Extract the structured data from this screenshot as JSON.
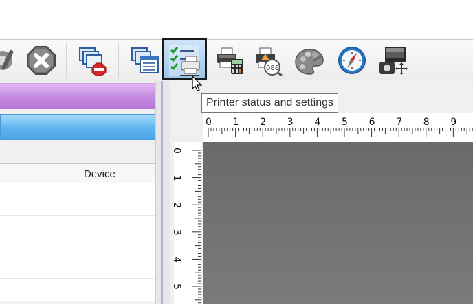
{
  "toolbar": {
    "buttons": [
      {
        "id": "tools",
        "icon": "tools-icon"
      },
      {
        "id": "cancel",
        "icon": "cancel-x-icon"
      },
      {
        "id": "stop-jobs",
        "icon": "stop-jobs-icon"
      },
      {
        "id": "job-list",
        "icon": "job-list-icon"
      },
      {
        "id": "printer-status",
        "icon": "printer-status-icon",
        "active": true
      },
      {
        "id": "printer-calculator",
        "icon": "printer-calculator-icon"
      },
      {
        "id": "printer-counter",
        "icon": "printer-counter-icon"
      },
      {
        "id": "palette",
        "icon": "palette-icon"
      },
      {
        "id": "compass",
        "icon": "compass-icon"
      },
      {
        "id": "image-move",
        "icon": "image-move-icon"
      }
    ]
  },
  "tooltip": {
    "text": "Printer status and settings"
  },
  "grid": {
    "columns": [
      "Device"
    ]
  },
  "ruler": {
    "horizontal": [
      "0",
      "1",
      "2",
      "3",
      "4",
      "5",
      "6",
      "7",
      "8",
      "9"
    ],
    "vertical": [
      "0",
      "1",
      "2",
      "3",
      "4",
      "5"
    ]
  },
  "colors": {
    "purple_bar": "#c48ae0",
    "blue_bar": "#62b7f0",
    "canvas": "#707070",
    "active_border": "#1a1a1a"
  }
}
